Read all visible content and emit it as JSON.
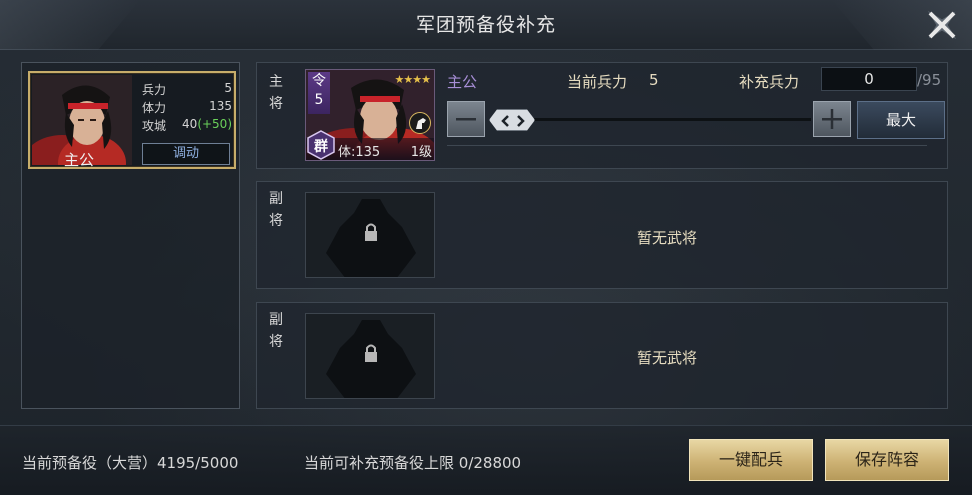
{
  "title": "军团预备役补充",
  "close_icon": "close-x-icon",
  "left_card": {
    "name": "主公",
    "stats": [
      {
        "label": "兵力",
        "value": "5",
        "bonus": ""
      },
      {
        "label": "体力",
        "value": "135",
        "bonus": ""
      },
      {
        "label": "攻城",
        "value": "40",
        "bonus": "(+50)"
      }
    ],
    "deploy_label": "调动"
  },
  "main_slot": {
    "role": "主将",
    "role_chars": [
      "主",
      "将"
    ],
    "general": {
      "name": "主公",
      "order_char": "令",
      "order_num": "5",
      "stars": "★★★★",
      "faction": "群",
      "hp_text": "体:135",
      "level_text": "1级"
    },
    "current_troops_label": "当前兵力",
    "current_troops_value": "5",
    "supplement_label": "补充兵力",
    "supplement_value": "0",
    "supplement_max": "/95",
    "slider_fraction": 0,
    "max_button": "最大",
    "minus_icon": "minus-icon",
    "plus_icon": "plus-icon"
  },
  "sub_slots": [
    {
      "role_chars": [
        "副",
        "将"
      ],
      "empty_text": "暂无武将"
    },
    {
      "role_chars": [
        "副",
        "将"
      ],
      "empty_text": "暂无武将"
    }
  ],
  "bottom": {
    "reserve_text": "当前预备役（大营）4195/5000",
    "limit_text": "当前可补充预备役上限 0/28800",
    "auto_button": "一键配兵",
    "save_button": "保存阵容"
  },
  "colors": {
    "accent_gold": "#c7ad6a",
    "general_name_purple": "#a78ed6",
    "bonus_green": "#6ad05a",
    "deploy_blue": "#8fb0e0"
  }
}
